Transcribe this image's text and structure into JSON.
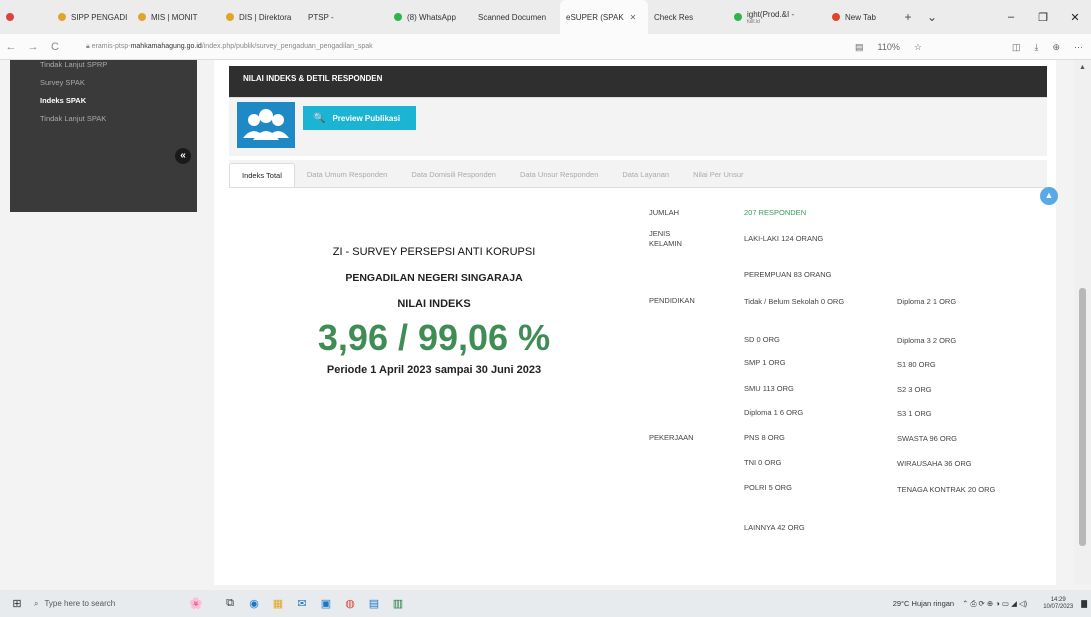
{
  "browser": {
    "tabs": [
      {
        "label": "SIPP PENGADI",
        "color": "#e0a526"
      },
      {
        "label": "MIS | MONIT",
        "color": "#e0a526"
      },
      {
        "label": "DIS | Direktora",
        "color": "#e0a526"
      },
      {
        "label": "PTSP -",
        "color": "#9aa3b0"
      },
      {
        "label": "(8) WhatsApp",
        "color": "#2fb44a"
      },
      {
        "label": "Scanned Documen",
        "color": "#9aa3b0"
      },
      {
        "label": "eSUPER (SPAK",
        "color": "#9aa3b0"
      },
      {
        "label": "Check Res",
        "color": "#9aa3b0"
      },
      {
        "label": "ight(Prod.&I -",
        "sublabel": "fulll.ld",
        "color": "#2fb44a"
      },
      {
        "label": "New Tab",
        "color": "#e0452c"
      }
    ],
    "new_tab": "+",
    "tab_list": "⌄",
    "window_controls": {
      "minimize": "–",
      "maximize": "❐",
      "close": "✕"
    },
    "nav": {
      "back": "←",
      "forward": "→",
      "reload": "C"
    },
    "url_prefix": "eramis-ptsp-",
    "url_domain": "mahkamahagung.go.id",
    "url_path": "/index.php/publik/survey_pengaduan_pengadilan_spak",
    "zoom": "110%",
    "addr_icons": [
      "▤",
      "☆",
      "◫",
      "⤓",
      "⊕",
      "⋯"
    ]
  },
  "sidebar": {
    "items": [
      "Tindak Lanjut SPRP",
      "Survey SPAK",
      "Indeks SPAK",
      "Tindak Lanjut SPAK"
    ],
    "collapse": "«"
  },
  "header": {
    "title": "NILAI INDEKS & DETIL RESPONDEN",
    "preview_button": "Preview Publikasi",
    "preview_icon": "🔍"
  },
  "tabs": [
    "Indeks Total",
    "Data Umum Responden",
    "Data Domisili Responden",
    "Data Unsur Responden",
    "Data Layanan",
    "Nilai Per Unsur"
  ],
  "scroll_up": "▲",
  "summary": {
    "survey_title": "ZI - SURVEY PERSEPSI ANTI KORUPSI",
    "court_name": "PENGADILAN NEGERI SINGARAJA",
    "index_label": "NILAI INDEKS",
    "index_value": "3,96 / 99,06 %",
    "period": "Periode 1 April 2023 sampai 30 Juni 2023"
  },
  "respondents": {
    "jumlah_label": "JUMLAH",
    "jumlah_value": "207 RESPONDEN",
    "gender_label": "JENIS KELAMIN",
    "gender": [
      "LAKI-LAKI  124 ORANG",
      "PEREMPUAN  83 ORANG"
    ],
    "education_label": "PENDIDIKAN",
    "education_left": [
      "Tidak / Belum Sekolah  0 ORG",
      "SD  0 ORG",
      "SMP  1 ORG",
      "SMU  113 ORG",
      "Diploma 1  6 ORG"
    ],
    "education_right": [
      "Diploma 2  1 ORG",
      "Diploma 3  2 ORG",
      "S1  80 ORG",
      "S2  3 ORG",
      "S3  1 ORG"
    ],
    "job_label": "PEKERJAAN",
    "job_left": [
      "PNS  8 ORG",
      "TNI  0 ORG",
      "POLRI  5 ORG",
      "LAINNYA  42 ORG"
    ],
    "job_right": [
      "SWASTA  96 ORG",
      "WIRAUSAHA  36 ORG",
      "TENAGA KONTRAK  20 ORG"
    ]
  },
  "taskbar": {
    "start": "⊞",
    "search_icon": "⌕",
    "search_placeholder": "Type here to search",
    "apps": [
      "⧉",
      "◉",
      "▦",
      "✉",
      "▣",
      "◍",
      "▤",
      "▥"
    ],
    "weather": "29°C  Hujan ringan",
    "tray_icons": "⌃ ⎙ ⟳ ⊕ ◑ ▭ ◢ ◁)",
    "time": "14:29",
    "date": "10/07/2023",
    "notification": "▇"
  }
}
